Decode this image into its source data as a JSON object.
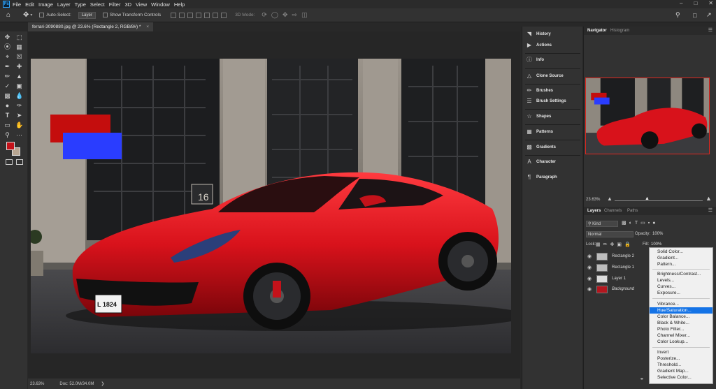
{
  "menubar": {
    "items": [
      "File",
      "Edit",
      "Image",
      "Layer",
      "Type",
      "Select",
      "Filter",
      "3D",
      "View",
      "Window",
      "Help"
    ],
    "logo": "Ps"
  },
  "options": {
    "auto_select": "Auto-Select:",
    "layer_value": "Layer",
    "show_transform": "Show Transform Controls",
    "mode_3d": "3D Mode:"
  },
  "document": {
    "tab_title": "ferrari-3090880.jpg @ 23.6% (Rectangle 2, RGB/8#) *",
    "zoom": "23.63%",
    "doc_size": "Doc: 52.0M/34.0M"
  },
  "panels": {
    "items": [
      "History",
      "Actions",
      "Info",
      "Clone Source",
      "Brushes",
      "Brush Settings",
      "Shapes",
      "Patterns",
      "Gradients",
      "Character",
      "Paragraph"
    ],
    "navigator_tab": "Navigator",
    "histogram_tab": "Histogram",
    "nav_zoom": "23.63%",
    "layers_tab": "Layers",
    "channels_tab": "Channels",
    "paths_tab": "Paths",
    "kind": "Kind",
    "blend": "Normal",
    "opacity_label": "Opacity:",
    "opacity_value": "100%",
    "lock_label": "Lock:",
    "fill_label": "Fill:",
    "fill_value": "100%"
  },
  "layers": [
    {
      "name": "Rectangle 2"
    },
    {
      "name": "Rectangle 1"
    },
    {
      "name": "Layer 1"
    },
    {
      "name": "Background"
    }
  ],
  "adjust_menu": {
    "groups": [
      [
        "Solid Color...",
        "Gradient...",
        "Pattern..."
      ],
      [
        "Brightness/Contrast...",
        "Levels...",
        "Curves...",
        "Exposure..."
      ],
      [
        "Vibrance...",
        "Hue/Saturation...",
        "Color Balance...",
        "Black & White...",
        "Photo Filter...",
        "Channel Mixer...",
        "Color Lookup..."
      ],
      [
        "Invert",
        "Posterize...",
        "Threshold...",
        "Gradient Map...",
        "Selective Color..."
      ]
    ],
    "highlighted": "Hue/Saturation..."
  },
  "canvas_text": {
    "plate": "L 1824",
    "door_number": "16"
  },
  "colors": {
    "accent": "#1473e6",
    "foreground": "#c4121a",
    "rect1": "#c40d0d",
    "rect2": "#2a3dff",
    "car": "#d8121b"
  }
}
